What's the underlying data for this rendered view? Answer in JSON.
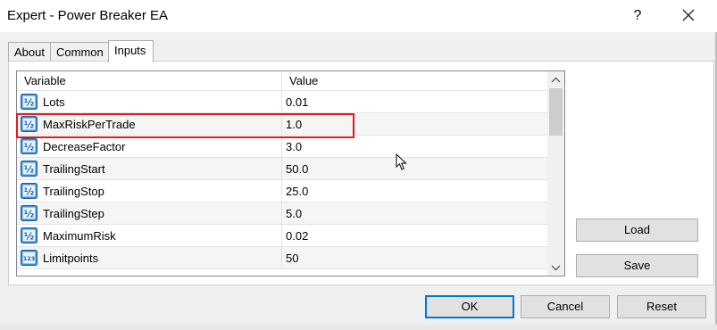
{
  "window": {
    "title": "Expert - Power Breaker EA",
    "help_label": "?",
    "close_icon": "close-icon"
  },
  "tabs": [
    {
      "label": "About",
      "active": false
    },
    {
      "label": "Common",
      "active": false
    },
    {
      "label": "Inputs",
      "active": true
    }
  ],
  "table": {
    "columns": [
      "Variable",
      "Value"
    ],
    "rows": [
      {
        "name": "Lots",
        "value": "0.01",
        "icon": "double-param-icon",
        "icon_text": "½"
      },
      {
        "name": "MaxRiskPerTrade",
        "value": "1.0",
        "icon": "double-param-icon",
        "icon_text": "½",
        "highlighted": true
      },
      {
        "name": "DecreaseFactor",
        "value": "3.0",
        "icon": "double-param-icon",
        "icon_text": "½"
      },
      {
        "name": "TrailingStart",
        "value": "50.0",
        "icon": "double-param-icon",
        "icon_text": "½"
      },
      {
        "name": "TrailingStop",
        "value": "25.0",
        "icon": "double-param-icon",
        "icon_text": "½"
      },
      {
        "name": "TrailingStep",
        "value": "5.0",
        "icon": "double-param-icon",
        "icon_text": "½"
      },
      {
        "name": "MaximumRisk",
        "value": "0.02",
        "icon": "double-param-icon",
        "icon_text": "½"
      },
      {
        "name": "Limitpoints",
        "value": "50",
        "icon": "integer-param-icon",
        "icon_text": "123"
      }
    ]
  },
  "side_buttons": {
    "load": "Load",
    "save": "Save"
  },
  "footer_buttons": {
    "ok": "OK",
    "cancel": "Cancel",
    "reset": "Reset"
  },
  "colors": {
    "accent": "#0078d7",
    "highlight": "#e0191c",
    "icon_blue": "#3a8fd8"
  }
}
